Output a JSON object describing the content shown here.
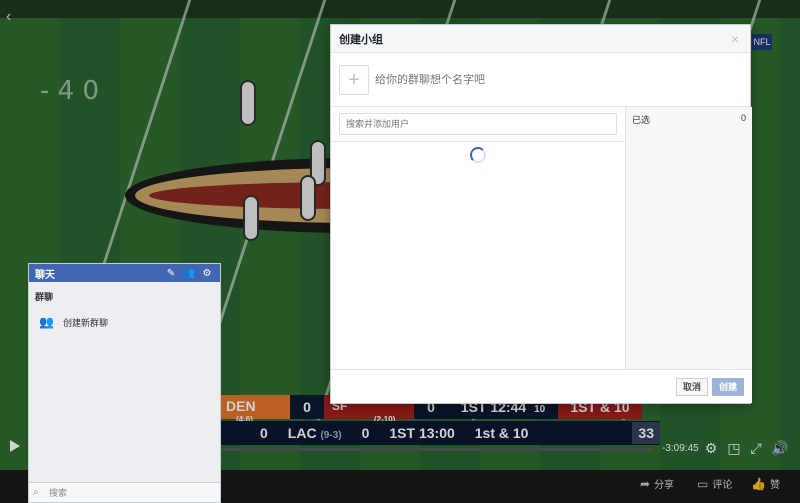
{
  "video": {
    "yard_left": "- 4 0",
    "scoreboard_top": {
      "team1": "DEN",
      "team1_record": "(4-6)",
      "team1_score": "0",
      "team2": "SF",
      "team2_record": "(2-10)",
      "team2_score": "0",
      "clock": "1ST 12:44",
      "clock_sub": "10",
      "down": "1ST & 10"
    },
    "scoreboard_bottom": {
      "left_score": "0",
      "team": "LAC",
      "record": "(9-3)",
      "team_score": "0",
      "clock": "1ST 13:00",
      "down": "1st & 10",
      "badge": "33"
    },
    "time_remaining": "-3:09:45",
    "nfl_badge": "NFL"
  },
  "social": {
    "share": "分享",
    "comment": "评论",
    "like": "赞"
  },
  "chat": {
    "title": "聊天",
    "section": "群聊",
    "create_group": "创建新群聊",
    "search_placeholder": "搜索"
  },
  "modal": {
    "title": "创建小组",
    "name_placeholder": "给你的群聊想个名字吧",
    "search_placeholder": "搜索并添加用户",
    "selected_label": "已选",
    "selected_count": "0",
    "cancel": "取消",
    "create": "创建"
  },
  "icons": {
    "close": "close-icon",
    "plus": "plus-icon",
    "spinner": "loading-spinner-icon",
    "compose": "compose-icon",
    "people": "people-icon",
    "gear": "gear-icon"
  },
  "colors": {
    "accent": "#4267b2",
    "create_disabled": "#9cb4d8"
  }
}
